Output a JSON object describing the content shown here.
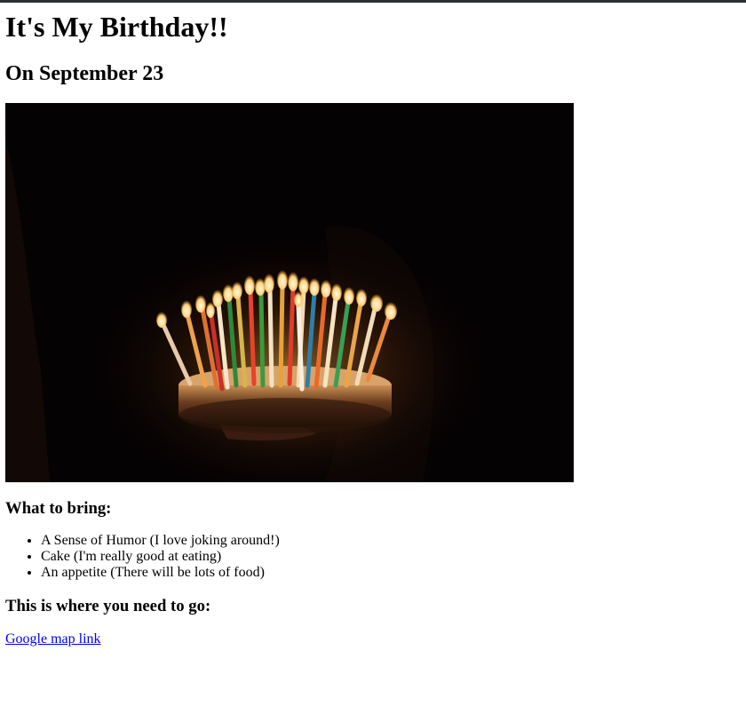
{
  "page": {
    "title": "It's My Birthday!!",
    "subtitle": "On September 23"
  },
  "photo": {
    "subject": "birthday-cake-with-lit-candles"
  },
  "bring": {
    "heading": "What to bring:",
    "items": [
      "A Sense of Humor (I love joking around!)",
      "Cake (I'm really good at eating)",
      "An appetite (There will be lots of food)"
    ]
  },
  "directions": {
    "heading": "This is where you need to go:",
    "link_label": "Google map link"
  },
  "colors": {
    "link": "#0000ee",
    "top_border": "#2b3035"
  }
}
